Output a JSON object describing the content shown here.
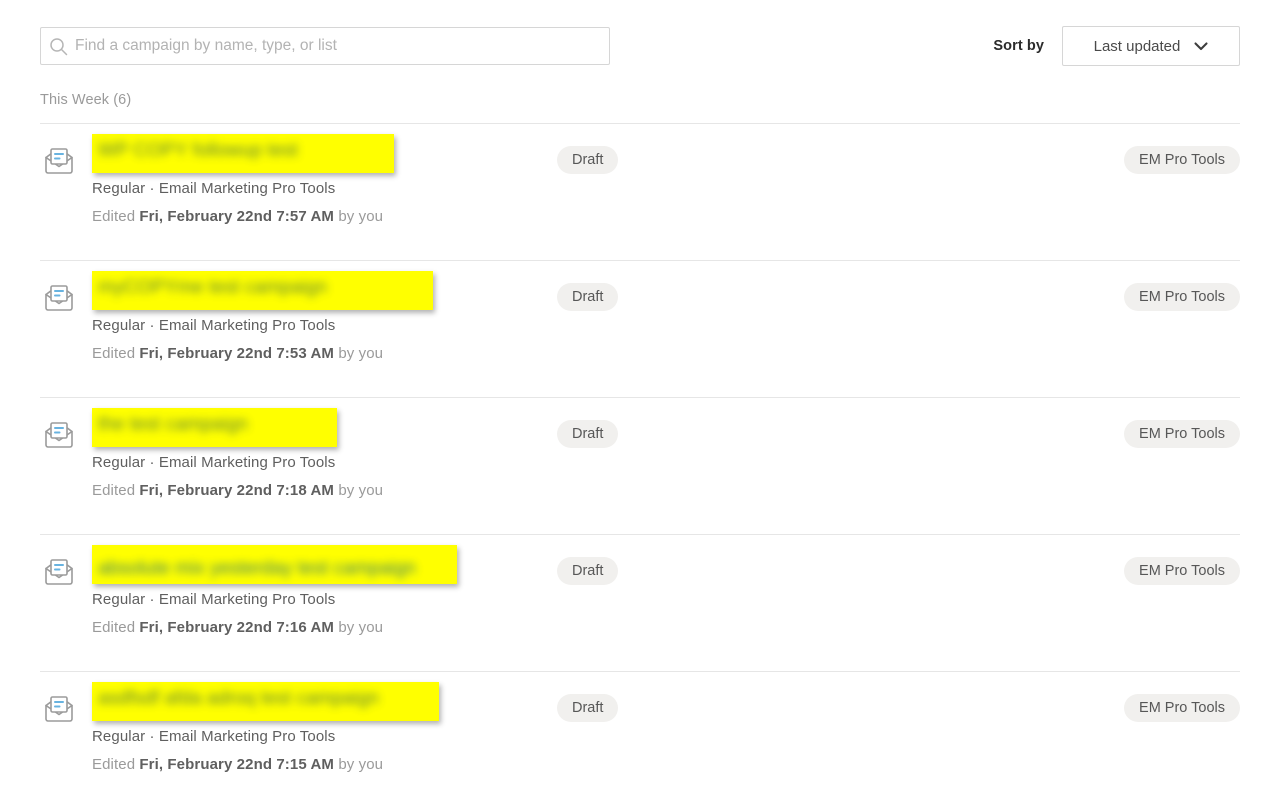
{
  "search": {
    "placeholder": "Find a campaign by name, type, or list",
    "value": "",
    "icon": "search-icon"
  },
  "sort": {
    "label": "Sort by",
    "selected": "Last updated",
    "icon": "chevron-down-icon",
    "options": [
      "Last updated"
    ]
  },
  "section": {
    "title": "This Week (6)"
  },
  "colors": {
    "redaction": "#ffff00",
    "pill_bg": "#f1f0ee",
    "border": "#e6e6e6",
    "muted_text": "#9a9a9a",
    "body_text": "#5f5f5f"
  },
  "campaigns": [
    {
      "icon": "email-campaign-icon",
      "title_redacted": "WP COPY followup test",
      "title_width": 302,
      "title_style": "green",
      "type": "Regular · Email Marketing Pro Tools",
      "edited_prefix": "Edited",
      "edited_date": "Fri, February 22nd 7:57 AM",
      "edited_suffix": "by you",
      "status": "Draft",
      "audience": "EM Pro Tools"
    },
    {
      "icon": "email-campaign-icon",
      "title_redacted": "myCOPYme test campaign",
      "title_width": 341,
      "title_style": "green",
      "type": "Regular · Email Marketing Pro Tools",
      "edited_prefix": "Edited",
      "edited_date": "Fri, February 22nd 7:53 AM",
      "edited_suffix": "by you",
      "status": "Draft",
      "audience": "EM Pro Tools"
    },
    {
      "icon": "email-campaign-icon",
      "title_redacted": "the test campaign",
      "title_width": 245,
      "title_style": "green",
      "type": "Regular · Email Marketing Pro Tools",
      "edited_prefix": "Edited",
      "edited_date": "Fri, February 22nd 7:18 AM",
      "edited_suffix": "by you",
      "status": "Draft",
      "audience": "EM Pro Tools"
    },
    {
      "icon": "email-campaign-icon",
      "title_redacted": "absolute mix yesterday test campaign",
      "title_width": 365,
      "title_style": "teal",
      "type": "Regular · Email Marketing Pro Tools",
      "edited_prefix": "Edited",
      "edited_date": "Fri, February 22nd 7:16 AM",
      "edited_suffix": "by you",
      "status": "Draft",
      "audience": "EM Pro Tools"
    },
    {
      "icon": "email-campaign-icon",
      "title_redacted": "asdfsdf afda adroq test campaign",
      "title_width": 347,
      "title_style": "green",
      "type": "Regular · Email Marketing Pro Tools",
      "edited_prefix": "Edited",
      "edited_date": "Fri, February 22nd 7:15 AM",
      "edited_suffix": "by you",
      "status": "Draft",
      "audience": "EM Pro Tools"
    }
  ]
}
